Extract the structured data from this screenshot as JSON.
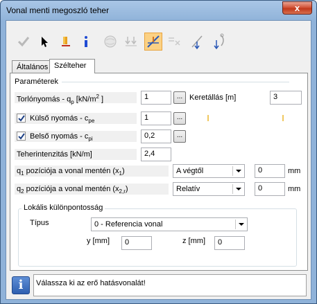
{
  "window": {
    "title": "Vonal menti megoszló teher",
    "close_label": "x"
  },
  "toolbar": {
    "icons": [
      "checkmark-icon",
      "pointer-icon",
      "color-pencil-icon",
      "info-icon",
      "sphere-icon",
      "arrows-down-icon",
      "load-line-icon",
      "select-line-icon",
      "line-arrow-icon",
      "curve-arrow-icon"
    ],
    "active": "load-line-icon"
  },
  "tabs": [
    {
      "label": "Általános"
    },
    {
      "label": "Szélteher"
    }
  ],
  "params": {
    "section_label": "Paraméterek",
    "qp_label": "Torlónyomás - q",
    "qp_sub": "p",
    "qp_unit": " [kN/m",
    "qp_sup": "2",
    "qp_unit_end": " ]",
    "qp_value": "1",
    "frame_spacing_label": "Keretállás [m]",
    "frame_spacing_value": "3",
    "cpe_label": "Külső nyomás - c",
    "cpe_sub": "pe",
    "cpe_checked": true,
    "cpe_value": "1",
    "cpi_label": "Belső nyomás - c",
    "cpi_sub": "pi",
    "cpi_checked": true,
    "cpi_value": "0,2",
    "intensity_label": "Teherintenzitás [kN/m]",
    "intensity_value": "2,4",
    "q1_label_a": "q",
    "q1_sub": "1",
    "q1_label_b": " pozíciója a vonal mentén (x",
    "q1_sub2": "1",
    "q1_label_c": ")",
    "q1_mode": "A végtől",
    "q1_value": "0",
    "q1_unit": "mm",
    "q2_label_a": "q",
    "q2_sub": "2",
    "q2_label_b": " pozíciója a vonal mentén (x",
    "q2_sub2": "2,r",
    "q2_label_c": ")",
    "q2_mode": "Relatív",
    "q2_value": "0",
    "q2_unit": "mm",
    "dots_label": "..."
  },
  "local": {
    "group_label": "Lokális különpontosság",
    "type_label": "Típus",
    "type_value": "0 - Referencia vonal",
    "y_label": "y [mm]",
    "y_value": "0",
    "z_label": "z [mm]",
    "z_value": "0"
  },
  "status": {
    "text": "Válassza ki az erő hatásvonalát!",
    "icon_glyph": "i"
  }
}
